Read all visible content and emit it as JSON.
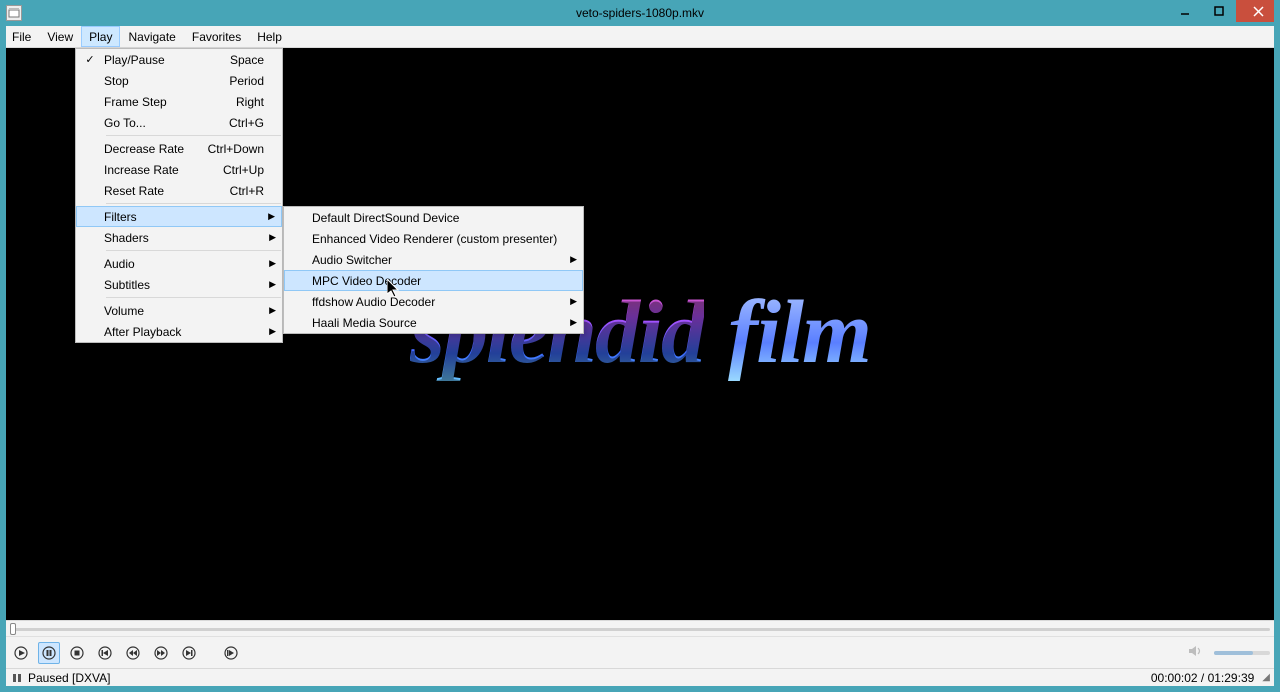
{
  "window": {
    "title": "veto-spiders-1080p.mkv"
  },
  "menubar": {
    "file": "File",
    "view": "View",
    "play": "Play",
    "navigate": "Navigate",
    "favorites": "Favorites",
    "help": "Help"
  },
  "play_menu": {
    "play_pause": {
      "label": "Play/Pause",
      "accel": "Space",
      "checked": true
    },
    "stop": {
      "label": "Stop",
      "accel": "Period"
    },
    "frame_step": {
      "label": "Frame Step",
      "accel": "Right"
    },
    "go_to": {
      "label": "Go To...",
      "accel": "Ctrl+G"
    },
    "decrease_rate": {
      "label": "Decrease Rate",
      "accel": "Ctrl+Down"
    },
    "increase_rate": {
      "label": "Increase Rate",
      "accel": "Ctrl+Up"
    },
    "reset_rate": {
      "label": "Reset Rate",
      "accel": "Ctrl+R"
    },
    "filters": {
      "label": "Filters"
    },
    "shaders": {
      "label": "Shaders"
    },
    "audio": {
      "label": "Audio"
    },
    "subtitles": {
      "label": "Subtitles"
    },
    "volume": {
      "label": "Volume"
    },
    "after_playback": {
      "label": "After Playback"
    }
  },
  "filters_menu": {
    "default_directsound": "Default DirectSound Device",
    "enhanced_video_renderer": "Enhanced Video Renderer (custom presenter)",
    "audio_switcher": "Audio Switcher",
    "mpc_video_decoder": "MPC Video Decoder",
    "ffdshow_audio_decoder": "ffdshow Audio Decoder",
    "haali_media_source": "Haali Media Source"
  },
  "video_overlay": {
    "word1": "splendid",
    "word2": "film"
  },
  "status": {
    "text": "Paused [DXVA]",
    "elapsed": "00:00:02",
    "total": "01:29:39",
    "sep": " / "
  }
}
